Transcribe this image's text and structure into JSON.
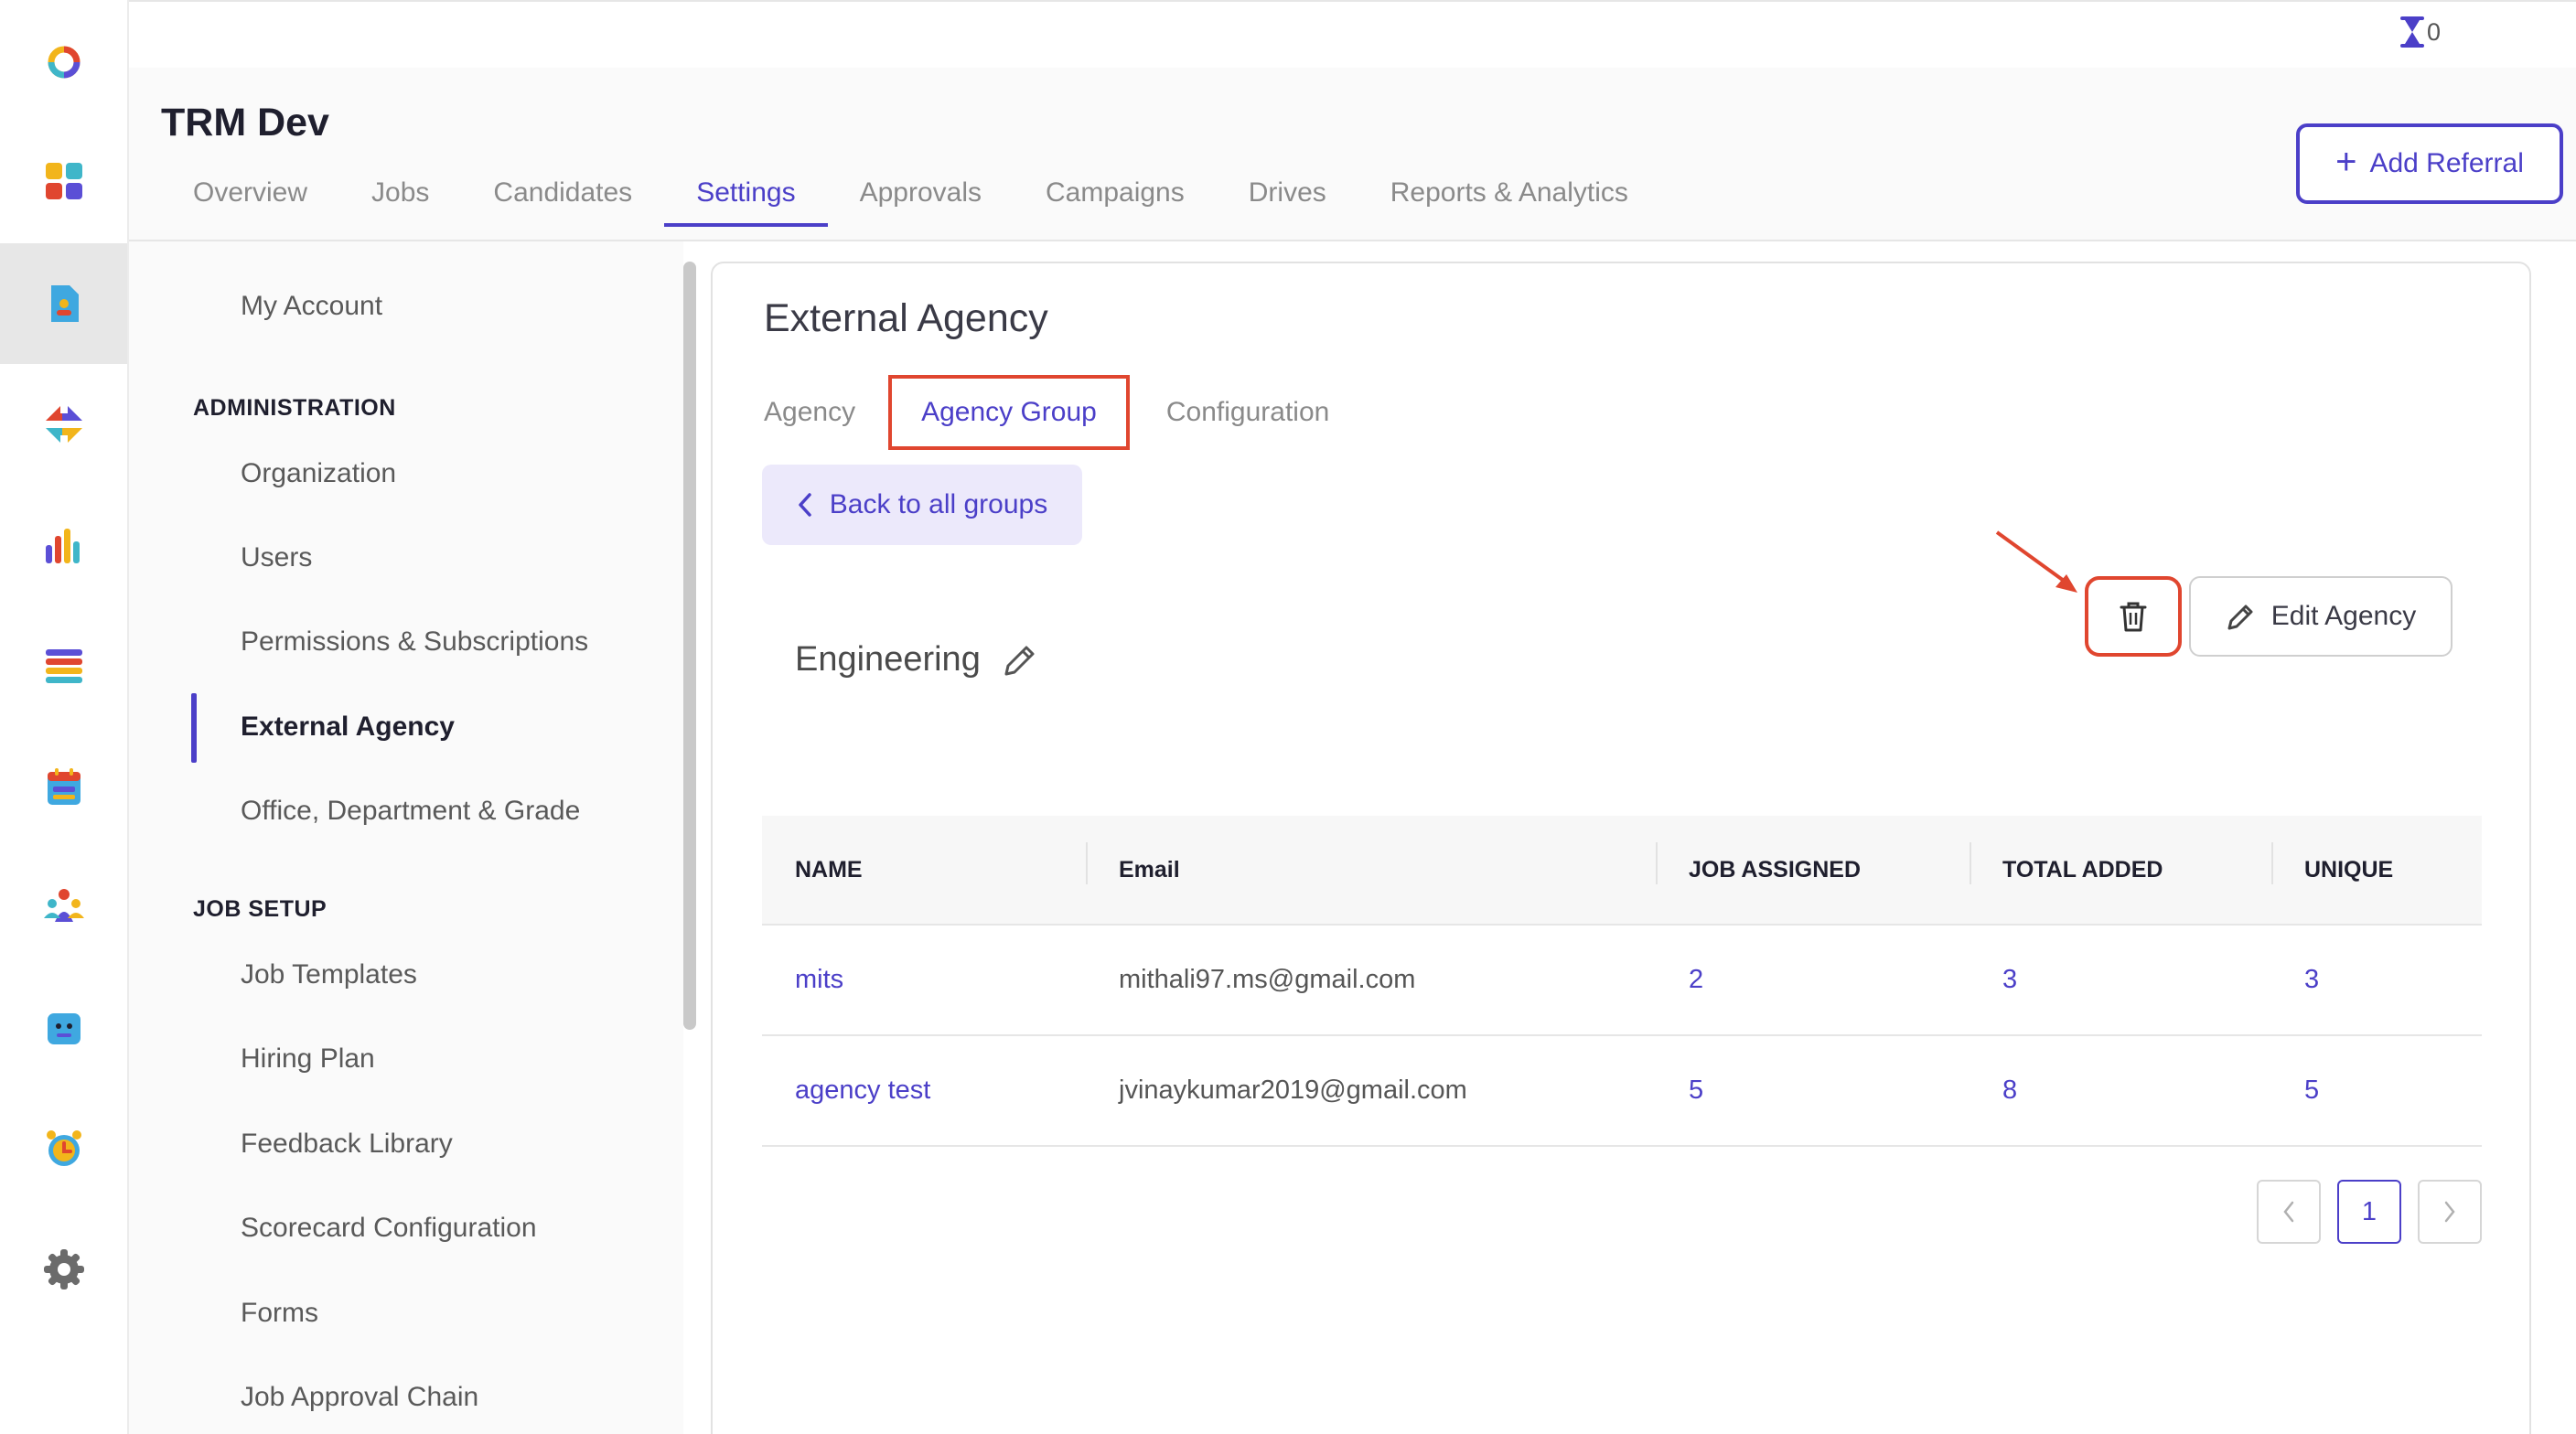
{
  "top_bar": {
    "timer_count": "0"
  },
  "header": {
    "title": "TRM Dev",
    "tabs": [
      "Overview",
      "Jobs",
      "Candidates",
      "Settings",
      "Approvals",
      "Campaigns",
      "Drives",
      "Reports & Analytics"
    ],
    "active_tab": "Settings",
    "add_referral_label": "Add Referral"
  },
  "settings_nav": {
    "my_account": "My Account",
    "administration_heading": "ADMINISTRATION",
    "administration_items": [
      "Organization",
      "Users",
      "Permissions & Subscriptions",
      "External Agency",
      "Office, Department & Grade"
    ],
    "active_item": "External Agency",
    "job_setup_heading": "JOB SETUP",
    "job_setup_items": [
      "Job Templates",
      "Hiring Plan",
      "Feedback Library",
      "Scorecard Configuration",
      "Forms",
      "Job Approval Chain"
    ]
  },
  "content": {
    "title": "External Agency",
    "sub_tabs": [
      "Agency",
      "Agency Group",
      "Configuration"
    ],
    "active_sub_tab": "Agency Group",
    "back_label": "Back to all groups",
    "group_name": "Engineering",
    "edit_agency_label": "Edit Agency",
    "table": {
      "headers": [
        "NAME",
        "Email",
        "JOB ASSIGNED",
        "TOTAL ADDED",
        "UNIQUE"
      ],
      "rows": [
        {
          "name": "mits",
          "email": "mithali97.ms@gmail.com",
          "job_assigned": "2",
          "total_added": "3",
          "unique": "3"
        },
        {
          "name": "agency test",
          "email": "jvinaykumar2019@gmail.com",
          "job_assigned": "5",
          "total_added": "8",
          "unique": "5"
        }
      ]
    },
    "pagination": {
      "current_page": "1"
    }
  },
  "colors": {
    "accent": "#4b3fc8",
    "annotation": "#e0462f"
  },
  "icons": {
    "rail": [
      "app-logo-icon",
      "dashboard-icon",
      "jobs-doc-icon",
      "referrals-arrows-icon",
      "analytics-bars-icon",
      "list-icon",
      "calendar-icon",
      "team-icon",
      "bot-icon",
      "alarm-clock-icon",
      "settings-gear-icon"
    ],
    "top": [
      "hourglass-icon",
      "bell-icon",
      "help-icon"
    ]
  }
}
